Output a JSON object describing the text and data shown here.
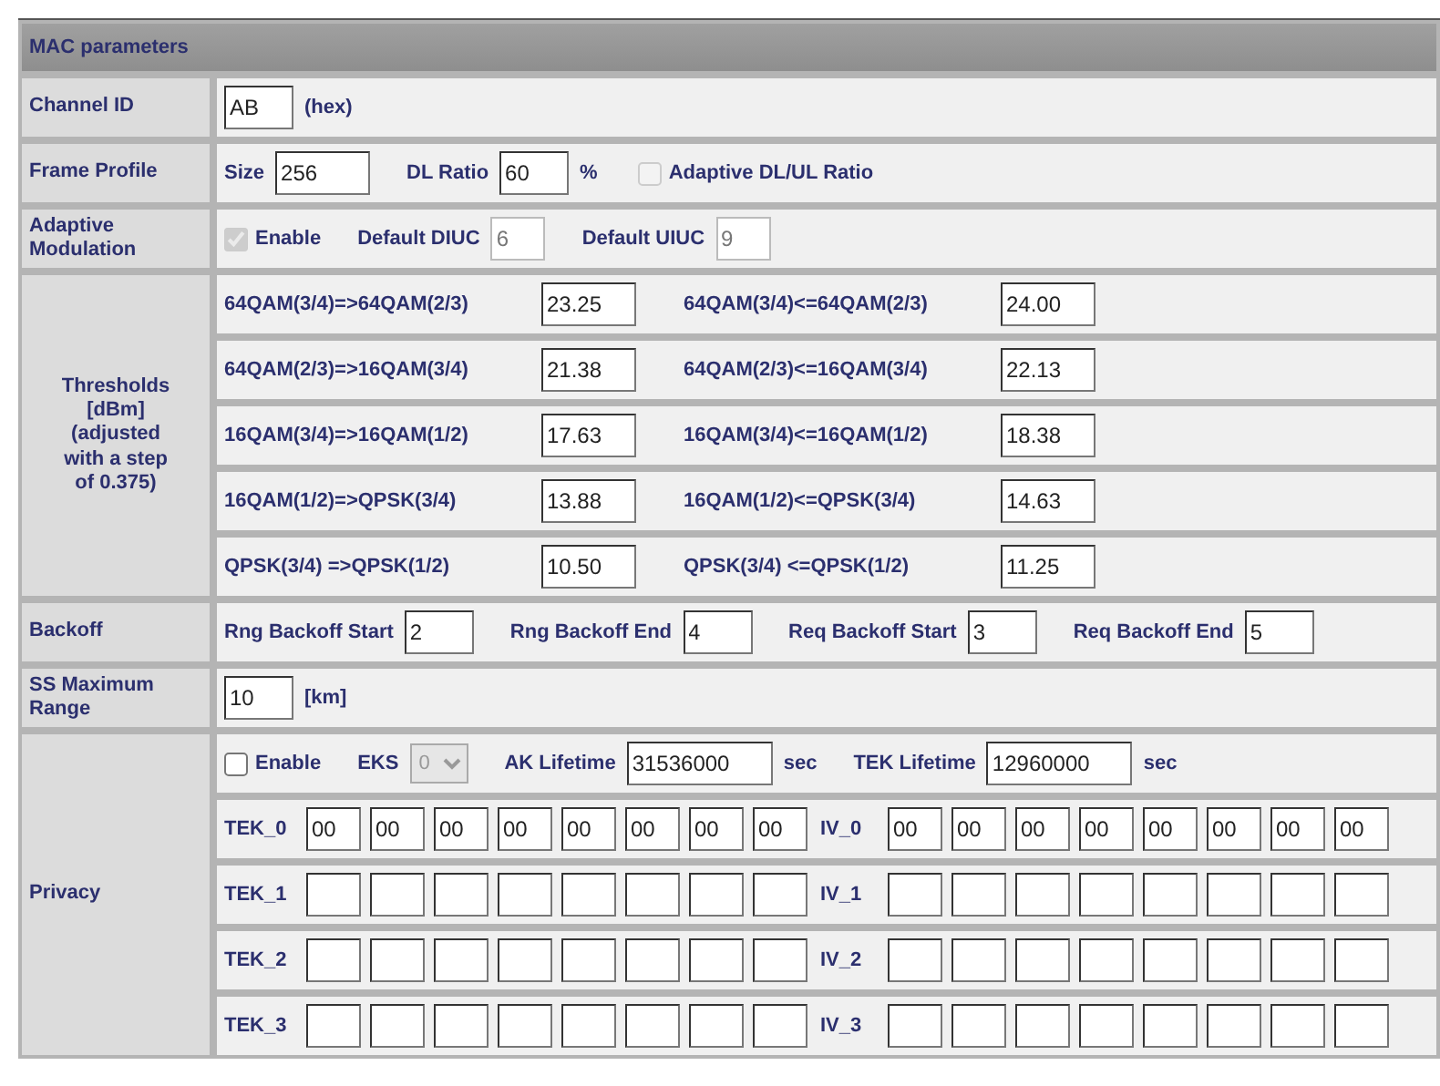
{
  "header": {
    "title": "MAC parameters"
  },
  "sections": [
    {
      "label": "Channel ID",
      "lines": [
        [
          {
            "kind": "field",
            "value": "AB"
          },
          {
            "kind": "unit",
            "text": "(hex)"
          }
        ]
      ]
    },
    {
      "label": "Frame Profile",
      "lines": [
        [
          {
            "kind": "label",
            "text": "Size"
          },
          {
            "kind": "wide-field",
            "value": "256"
          },
          {
            "kind": "label",
            "text": "DL Ratio"
          },
          {
            "kind": "field",
            "value": "60"
          },
          {
            "kind": "unit",
            "text": "%"
          },
          {
            "kind": "checkbox",
            "text": "Adaptive DL/UL Ratio",
            "checked": false,
            "disabled": true
          }
        ]
      ]
    },
    {
      "label": "Adaptive Modulation",
      "lines": [
        [
          {
            "kind": "checkbox",
            "text": "Enable",
            "checked": true,
            "disabled": true
          },
          {
            "kind": "label",
            "text": "Default DIUC"
          },
          {
            "kind": "byte-field",
            "value": "6",
            "disabled": true
          },
          {
            "kind": "label",
            "text": "Default UIUC"
          },
          {
            "kind": "byte-field",
            "value": "9",
            "disabled": true
          }
        ]
      ]
    },
    {
      "label": "Thresholds\n[dBm]\n(adjusted\nwith a step\nof 0.375)",
      "lines": [
        [
          {
            "kind": "pair-label",
            "text": "64QAM(3/4)=>64QAM(2/3)"
          },
          {
            "kind": "wide-field",
            "value": "23.25"
          },
          {
            "kind": "pair-label",
            "text": "64QAM(3/4)<=64QAM(2/3)"
          },
          {
            "kind": "wide-field",
            "value": "24.00"
          }
        ],
        [
          {
            "kind": "pair-label",
            "text": "64QAM(2/3)=>16QAM(3/4)"
          },
          {
            "kind": "wide-field",
            "value": "21.38"
          },
          {
            "kind": "pair-label",
            "text": "64QAM(2/3)<=16QAM(3/4)"
          },
          {
            "kind": "wide-field",
            "value": "22.13"
          }
        ],
        [
          {
            "kind": "pair-label",
            "text": "16QAM(3/4)=>16QAM(1/2)"
          },
          {
            "kind": "wide-field",
            "value": "17.63"
          },
          {
            "kind": "pair-label",
            "text": "16QAM(3/4)<=16QAM(1/2)"
          },
          {
            "kind": "wide-field",
            "value": "18.38"
          }
        ],
        [
          {
            "kind": "pair-label",
            "text": "16QAM(1/2)=>QPSK(3/4)"
          },
          {
            "kind": "wide-field",
            "value": "13.88"
          },
          {
            "kind": "pair-label",
            "text": "16QAM(1/2)<=QPSK(3/4)"
          },
          {
            "kind": "wide-field",
            "value": "14.63"
          }
        ],
        [
          {
            "kind": "pair-label",
            "text": "QPSK(3/4) =>QPSK(1/2)"
          },
          {
            "kind": "wide-field",
            "value": "10.50"
          },
          {
            "kind": "pair-label",
            "text": "QPSK(3/4) <=QPSK(1/2)"
          },
          {
            "kind": "wide-field",
            "value": "11.25"
          }
        ]
      ]
    },
    {
      "label": "Backoff",
      "lines": [
        [
          {
            "kind": "label",
            "text": "Rng Backoff Start"
          },
          {
            "kind": "field",
            "value": "2"
          },
          {
            "kind": "label",
            "text": "Rng Backoff End"
          },
          {
            "kind": "field",
            "value": "4"
          },
          {
            "kind": "label",
            "text": "Req Backoff Start"
          },
          {
            "kind": "field",
            "value": "3"
          },
          {
            "kind": "label",
            "text": "Req Backoff End"
          },
          {
            "kind": "field",
            "value": "5"
          }
        ]
      ]
    },
    {
      "label": "SS Maximum Range",
      "lines": [
        [
          {
            "kind": "field",
            "value": "10"
          },
          {
            "kind": "unit",
            "text": "[km]"
          }
        ]
      ]
    },
    {
      "label": "Privacy",
      "lines": [
        [
          {
            "kind": "checkbox",
            "text": "Enable",
            "checked": false,
            "disabled": false
          },
          {
            "kind": "label",
            "text": "EKS"
          },
          {
            "kind": "select",
            "value": "0",
            "disabled": true
          },
          {
            "kind": "label",
            "text": "AK Lifetime"
          },
          {
            "kind": "long-field",
            "value": "31536000"
          },
          {
            "kind": "unit",
            "text": "sec"
          },
          {
            "kind": "label",
            "text": "TEK Lifetime"
          },
          {
            "kind": "long-field",
            "value": "12960000"
          },
          {
            "kind": "unit",
            "text": "sec"
          }
        ],
        [
          {
            "kind": "key-label",
            "text": "TEK_0"
          },
          {
            "kind": "byte-field",
            "value": "00"
          },
          {
            "kind": "byte-field",
            "value": "00"
          },
          {
            "kind": "byte-field",
            "value": "00"
          },
          {
            "kind": "byte-field",
            "value": "00"
          },
          {
            "kind": "byte-field",
            "value": "00"
          },
          {
            "kind": "byte-field",
            "value": "00"
          },
          {
            "kind": "byte-field",
            "value": "00"
          },
          {
            "kind": "byte-field",
            "value": "00"
          },
          {
            "kind": "key-label",
            "text": "IV_0"
          },
          {
            "kind": "byte-field",
            "value": "00"
          },
          {
            "kind": "byte-field",
            "value": "00"
          },
          {
            "kind": "byte-field",
            "value": "00"
          },
          {
            "kind": "byte-field",
            "value": "00"
          },
          {
            "kind": "byte-field",
            "value": "00"
          },
          {
            "kind": "byte-field",
            "value": "00"
          },
          {
            "kind": "byte-field",
            "value": "00"
          },
          {
            "kind": "byte-field",
            "value": "00"
          }
        ],
        [
          {
            "kind": "key-label",
            "text": "TEK_1"
          },
          {
            "kind": "byte-field"
          },
          {
            "kind": "byte-field"
          },
          {
            "kind": "byte-field"
          },
          {
            "kind": "byte-field"
          },
          {
            "kind": "byte-field"
          },
          {
            "kind": "byte-field"
          },
          {
            "kind": "byte-field"
          },
          {
            "kind": "byte-field"
          },
          {
            "kind": "key-label",
            "text": "IV_1"
          },
          {
            "kind": "byte-field"
          },
          {
            "kind": "byte-field"
          },
          {
            "kind": "byte-field"
          },
          {
            "kind": "byte-field"
          },
          {
            "kind": "byte-field"
          },
          {
            "kind": "byte-field"
          },
          {
            "kind": "byte-field"
          },
          {
            "kind": "byte-field"
          }
        ],
        [
          {
            "kind": "key-label",
            "text": "TEK_2"
          },
          {
            "kind": "byte-field"
          },
          {
            "kind": "byte-field"
          },
          {
            "kind": "byte-field"
          },
          {
            "kind": "byte-field"
          },
          {
            "kind": "byte-field"
          },
          {
            "kind": "byte-field"
          },
          {
            "kind": "byte-field"
          },
          {
            "kind": "byte-field"
          },
          {
            "kind": "key-label",
            "text": "IV_2"
          },
          {
            "kind": "byte-field"
          },
          {
            "kind": "byte-field"
          },
          {
            "kind": "byte-field"
          },
          {
            "kind": "byte-field"
          },
          {
            "kind": "byte-field"
          },
          {
            "kind": "byte-field"
          },
          {
            "kind": "byte-field"
          },
          {
            "kind": "byte-field"
          }
        ],
        [
          {
            "kind": "key-label",
            "text": "TEK_3"
          },
          {
            "kind": "byte-field"
          },
          {
            "kind": "byte-field"
          },
          {
            "kind": "byte-field"
          },
          {
            "kind": "byte-field"
          },
          {
            "kind": "byte-field"
          },
          {
            "kind": "byte-field"
          },
          {
            "kind": "byte-field"
          },
          {
            "kind": "byte-field"
          },
          {
            "kind": "key-label",
            "text": "IV_3"
          },
          {
            "kind": "byte-field"
          },
          {
            "kind": "byte-field"
          },
          {
            "kind": "byte-field"
          },
          {
            "kind": "byte-field"
          },
          {
            "kind": "byte-field"
          },
          {
            "kind": "byte-field"
          },
          {
            "kind": "byte-field"
          },
          {
            "kind": "byte-field"
          }
        ]
      ]
    }
  ]
}
